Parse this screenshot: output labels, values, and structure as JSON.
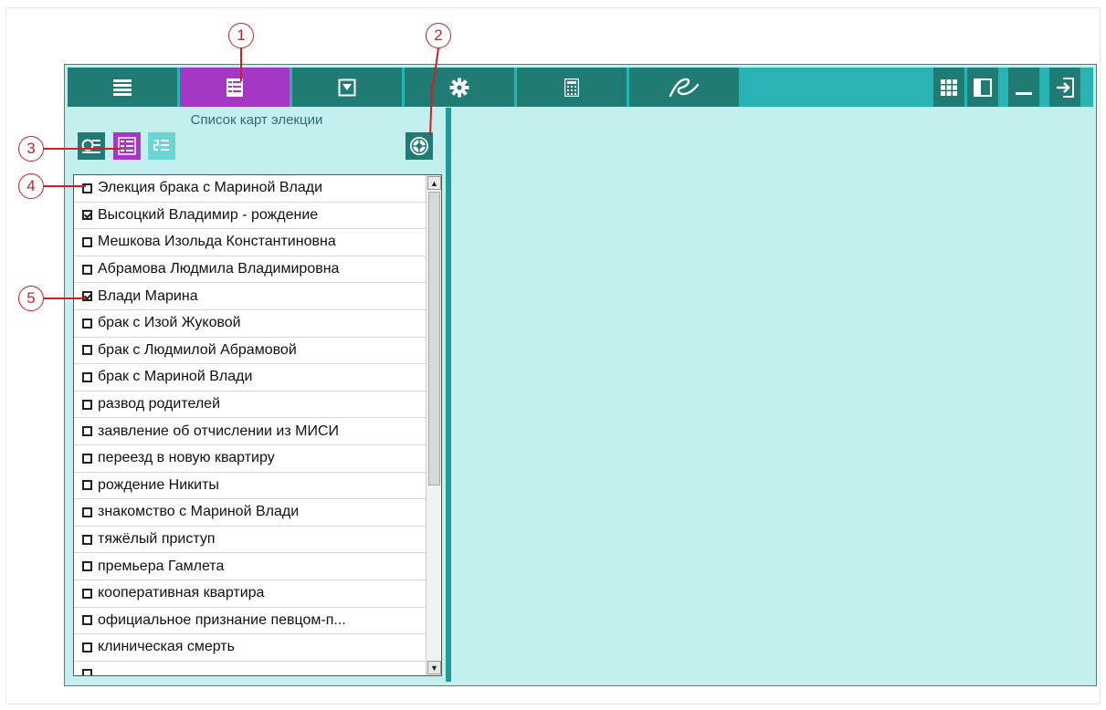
{
  "toolbar": {
    "buttons": [
      {
        "icon": "list-icon"
      },
      {
        "icon": "list-detail-icon",
        "active": true
      },
      {
        "icon": "dropdown-box-icon"
      },
      {
        "icon": "gear-icon"
      },
      {
        "icon": "calculator-icon"
      },
      {
        "icon": "signature-icon"
      }
    ],
    "right_buttons": [
      {
        "icon": "grid-icon"
      },
      {
        "icon": "panel-left-icon"
      },
      {
        "icon": "minimize-icon"
      },
      {
        "icon": "exit-icon"
      }
    ]
  },
  "left_panel": {
    "title": "Список карт элекции",
    "mode_buttons": [
      {
        "icon": "chart-list-icon"
      },
      {
        "icon": "table-list-icon",
        "active": true
      },
      {
        "icon": "numbered-list-icon"
      }
    ],
    "chart_button": {
      "icon": "natal-chart-icon"
    }
  },
  "list": {
    "items": [
      {
        "label": "Элекция брака с Мариной Влади",
        "checked": false
      },
      {
        "label": "Высоцкий Владимир - рождение",
        "checked": true
      },
      {
        "label": "Мешкова Изольда Константиновна",
        "checked": false
      },
      {
        "label": "Абрамова Людмила Владимировна",
        "checked": false
      },
      {
        "label": "Влади Марина",
        "checked": true
      },
      {
        "label": "брак с Изой Жуковой",
        "checked": false
      },
      {
        "label": "брак с Людмилой Абрамовой",
        "checked": false
      },
      {
        "label": "брак с Мариной Влади",
        "checked": false
      },
      {
        "label": "развод родителей",
        "checked": false
      },
      {
        "label": "заявление об отчислении из МИСИ",
        "checked": false
      },
      {
        "label": "переезд в новую квартиру",
        "checked": false
      },
      {
        "label": "рождение Никиты",
        "checked": false
      },
      {
        "label": "знакомство с Мариной Влади",
        "checked": false
      },
      {
        "label": "тяжёлый приступ",
        "checked": false
      },
      {
        "label": "премьера Гамлета",
        "checked": false
      },
      {
        "label": "кооперативная квартира",
        "checked": false
      },
      {
        "label": "официальное признание певцом-п...",
        "checked": false
      },
      {
        "label": "клиническая смерть",
        "checked": false
      },
      {
        "label": "",
        "checked": false
      }
    ]
  },
  "callouts": [
    "1",
    "2",
    "3",
    "4",
    "5"
  ],
  "colors": {
    "toolbar_bg": "#2ab3b4",
    "button_dark": "#1f7b73",
    "button_active": "#a437c3",
    "panel_bg": "#c3efef",
    "callout_red": "#d41e1e"
  }
}
